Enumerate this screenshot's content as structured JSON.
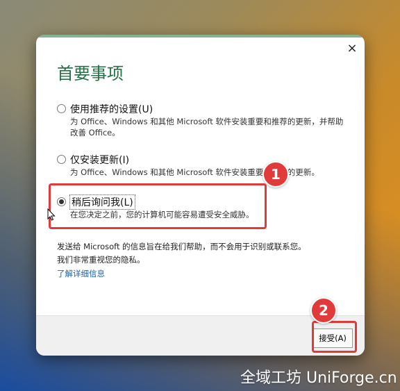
{
  "dialog": {
    "title": "首要事项",
    "close_label": "×",
    "options": [
      {
        "label": "使用推荐的设置(U)",
        "description": "为 Office、Windows 和其他 Microsoft 软件安装重要和推荐的更新，并帮助改善 Office。",
        "selected": false
      },
      {
        "label": "仅安装更新(I)",
        "description": "为 Office、Windows 和其他 Microsoft 软件安装重要和推荐的更新。",
        "selected": false
      },
      {
        "label": "稍后询问我(L)",
        "description": "在您决定之前，您的计算机可能容易遭受安全威胁。",
        "selected": true
      }
    ],
    "info_line1": "发送给 Microsoft 的信息旨在给我们帮助，而不会用于识别或联系您。",
    "info_line2": "我们非常重视您的隐私。",
    "learn_more_link": "了解详细信息",
    "accept_button": "接受(A)"
  },
  "annotations": {
    "badge1": "1",
    "badge2": "2",
    "highlight_color": "#e03a3a"
  },
  "watermark": "全域工坊 UniForge.cn",
  "colors": {
    "title": "#217346",
    "link": "#1f5fa8"
  }
}
